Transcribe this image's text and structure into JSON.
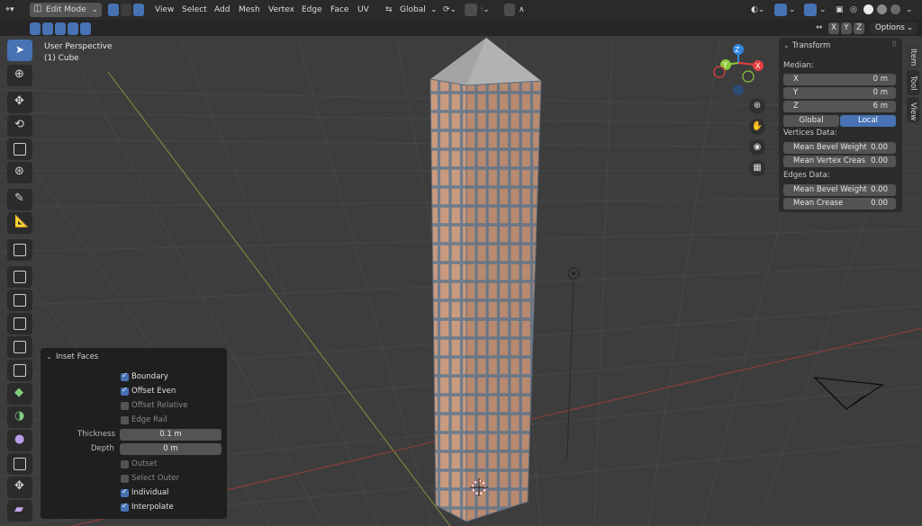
{
  "header": {
    "mode": "Edit Mode",
    "menus": [
      "View",
      "Select",
      "Add",
      "Mesh",
      "Vertex",
      "Edge",
      "Face",
      "UV"
    ],
    "transform_orientation": "Global",
    "options_label": "Options",
    "xyz": [
      "X",
      "Y",
      "Z"
    ]
  },
  "viewport": {
    "view_name": "User Perspective",
    "object_name": "(1) Cube",
    "gizmo_axes": [
      "Z",
      "Y",
      "X"
    ]
  },
  "n_panel": {
    "section_title": "Transform",
    "median_label": "Median:",
    "fields": [
      {
        "label": "X",
        "value": "0 m"
      },
      {
        "label": "Y",
        "value": "0 m"
      },
      {
        "label": "Z",
        "value": "6 m"
      }
    ],
    "toggle": {
      "left": "Global",
      "right": "Local",
      "active": "Local"
    },
    "vertices_label": "Vertices Data:",
    "vertex_fields": [
      {
        "label": "Mean Bevel Weight",
        "value": "0.00"
      },
      {
        "label": "Mean Vertex Creas",
        "value": "0.00"
      }
    ],
    "edges_label": "Edges Data:",
    "edge_fields": [
      {
        "label": "Mean Bevel Weight",
        "value": "0.00"
      },
      {
        "label": "Mean Crease",
        "value": "0.00"
      }
    ],
    "tabs": [
      "Item",
      "Tool",
      "View"
    ]
  },
  "operator_panel": {
    "title": "Inset Faces",
    "checkboxes_top": [
      {
        "label": "Boundary",
        "checked": true,
        "enabled": true
      },
      {
        "label": "Offset Even",
        "checked": true,
        "enabled": true
      },
      {
        "label": "Offset Relative",
        "checked": false,
        "enabled": false
      },
      {
        "label": "Edge Rail",
        "checked": false,
        "enabled": false
      }
    ],
    "thickness_label": "Thickness",
    "thickness_value": "0.1 m",
    "depth_label": "Depth",
    "depth_value": "0 m",
    "checkboxes_bottom": [
      {
        "label": "Outset",
        "checked": false,
        "enabled": false
      },
      {
        "label": "Select Outer",
        "checked": false,
        "enabled": false
      },
      {
        "label": "Individual",
        "checked": true,
        "enabled": true
      },
      {
        "label": "Interpolate",
        "checked": true,
        "enabled": true
      }
    ]
  },
  "colors": {
    "accent": "#4772b3",
    "face": "#c99a7e",
    "roof": "#a4a4a4",
    "axis_x": "#e4403f",
    "axis_y": "#8bc83a",
    "axis_z": "#2f86e3"
  }
}
